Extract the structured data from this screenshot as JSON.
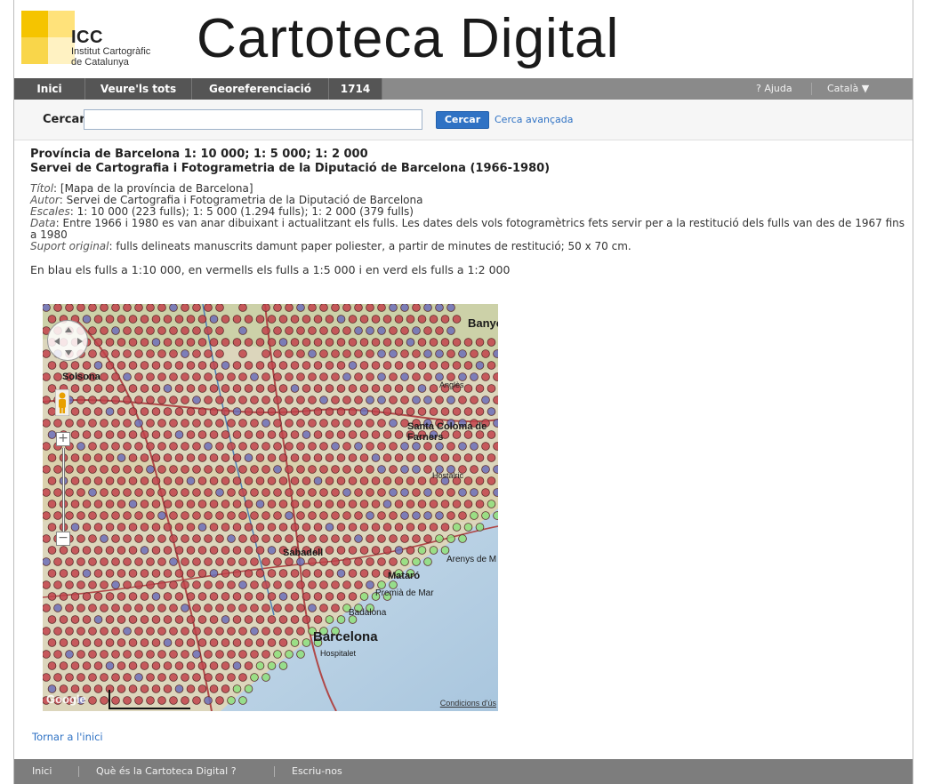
{
  "header": {
    "logo_abbr": "ICC",
    "logo_line1": "Institut Cartogràfic",
    "logo_line2": "de Catalunya",
    "site_title": "Cartoteca Digital"
  },
  "nav": {
    "items": [
      {
        "label": "Inici"
      },
      {
        "label": "Veure'ls tots"
      },
      {
        "label": "Georeferenciació"
      },
      {
        "label": "1714"
      }
    ],
    "help": "? Ajuda",
    "language": "Català ▼"
  },
  "search": {
    "label": "Cercar",
    "value": "",
    "button": "Cercar",
    "advanced": "Cerca avançada"
  },
  "record": {
    "title_line1": "Província de Barcelona 1: 10 000; 1: 5 000; 1: 2 000",
    "title_line2": "Servei de Cartografia i Fotogrametria de la Diputació de Barcelona (1966-1980)",
    "fields": [
      {
        "key": "Títol",
        "value": ": [Mapa de la província de Barcelona]"
      },
      {
        "key": "Autor",
        "value": ": Servei de Cartografia i Fotogrametria de la Diputació de Barcelona"
      },
      {
        "key": "Escales",
        "value": ": 1: 10 000 (223 fulls); 1: 5 000 (1.294 fulls); 1: 2 000 (379 fulls)"
      },
      {
        "key": "Data",
        "value": ": Entre 1966 i 1980 es van anar dibuixant i actualitzant els fulls. Les dates dels vols fotogramètrics fets servir per a la restitució dels fulls van des de 1967 fins a 1980"
      },
      {
        "key": "Suport original",
        "value": ": fulls delineats manuscrits damunt paper poliester, a partir de minutes de restitució; 50 x 70 cm."
      }
    ],
    "legend": "En blau els fulls a 1:10 000, en vermells els fulls a 1:5 000 i en verd els fulls a 1:2 000"
  },
  "map": {
    "place_labels": [
      "Banyo",
      "Solsona",
      "Santa Coloma de Farners",
      "Sabadell",
      "Mataró",
      "Premià de Mar",
      "Badalona",
      "Barcelona",
      "Hospitalet",
      "Arenys de M",
      "Anglès",
      "Hostalric"
    ],
    "terms": "Condicions d'ús",
    "brand": "Google",
    "colors": {
      "blue_sheets": "#6c6fb8",
      "red_sheets": "#c2434b",
      "green_sheets": "#8fe07d"
    }
  },
  "back_link": "Tornar a l'inici",
  "footer": {
    "items": [
      "Inici",
      "Què és la Cartoteca Digital ?",
      "Escriu-nos"
    ]
  }
}
